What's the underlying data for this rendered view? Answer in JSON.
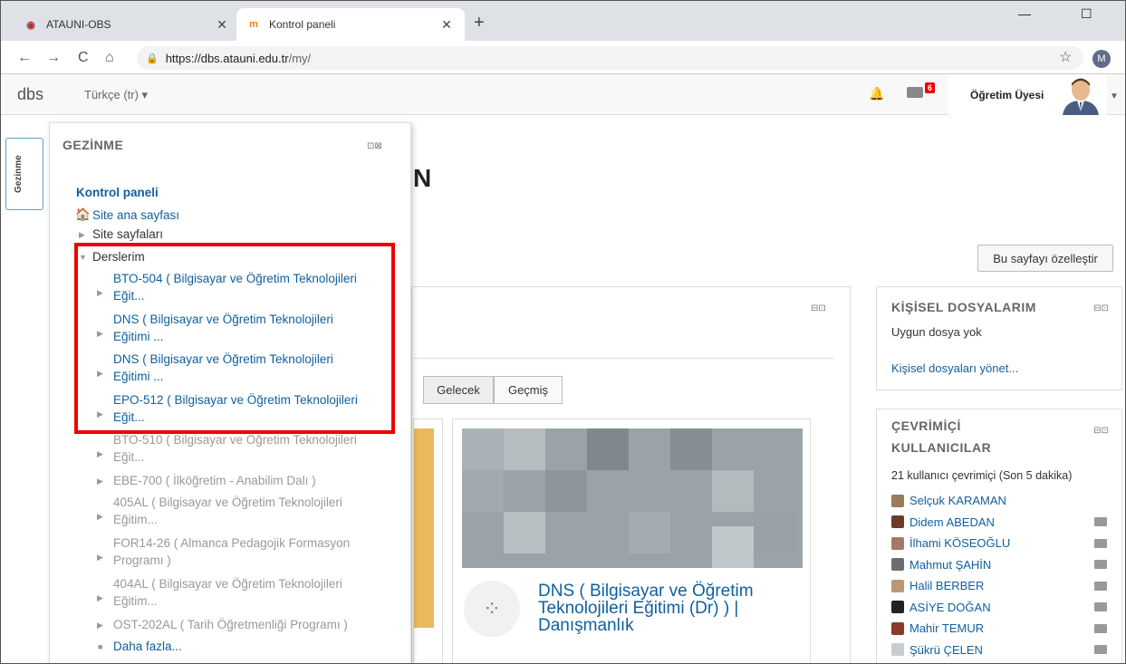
{
  "browser": {
    "tabs": [
      {
        "title": "ATAUNI-OBS",
        "favicon": "atauni-logo"
      },
      {
        "title": "Kontrol paneli",
        "favicon": "moodle-logo"
      }
    ],
    "url_host": "https://dbs.atauni.edu.tr",
    "url_path": "/my/",
    "profile_initial": "M"
  },
  "navbar": {
    "brand": "dbs",
    "language": "Türkçe (tr) ▾",
    "message_count": "6",
    "user_name": "Öğretim Üyesi"
  },
  "drawer_tab": "Gezinme",
  "nav": {
    "title": "GEZİNME",
    "dashboard": "Kontrol paneli",
    "site_home": "Site ana sayfası",
    "site_pages": "Site sayfaları",
    "my_courses": "Derslerim",
    "courses": [
      {
        "l1": "BTO-504 ( Bilgisayar ve Öğretim Teknolojileri",
        "l2": "Eğit..."
      },
      {
        "l1": "DNS ( Bilgisayar ve Öğretim Teknolojileri",
        "l2": "Eğitimi ..."
      },
      {
        "l1": "DNS ( Bilgisayar ve Öğretim Teknolojileri",
        "l2": "Eğitimi ..."
      },
      {
        "l1": "EPO-512 ( Bilgisayar ve Öğretim Teknolojileri",
        "l2": "Eğit..."
      },
      {
        "l1": "BTO-510 ( Bilgisayar ve Öğretim Teknolojileri",
        "l2": "Eğit..."
      },
      {
        "l1": "EBE-700 ( İlköğretim - Anabilim Dalı )",
        "l2": ""
      },
      {
        "l1": "405AL ( Bilgisayar ve Öğretim Teknolojileri",
        "l2": "Eğitim..."
      },
      {
        "l1": "FOR14-26 ( Almanca Pedagojik Formasyon",
        "l2": "Programı )"
      },
      {
        "l1": "404AL ( Bilgisayar ve Öğretim Teknolojileri",
        "l2": "Eğitim..."
      },
      {
        "l1": "OST-202AL ( Tarih Öğretmenliği Programı )",
        "l2": ""
      }
    ],
    "more": "Daha fazla..."
  },
  "main": {
    "heading_tail": "N",
    "customize_button": "Bu sayfayı özelleştir",
    "tab_future": "Gelecek",
    "tab_past": "Geçmiş",
    "course_card_title": "DNS ( Bilgisayar ve Öğretim Teknolojileri Eğitimi (Dr) ) | Danışmanlık"
  },
  "private_files": {
    "title": "KİŞİSEL DOSYALARIM",
    "empty": "Uygun dosya yok",
    "manage": "Kişisel dosyaları yönet..."
  },
  "online_users": {
    "title_l1": "ÇEVRİMİÇİ",
    "title_l2": "KULLANICILAR",
    "summary": "21 kullanıcı çevrimiçi (Son 5 dakika)",
    "users": [
      "Selçuk KARAMAN",
      "Didem ABEDAN",
      "İlhami KÖSEOĞLU",
      "Mahmut ŞAHİN",
      "Halil BERBER",
      "ASİYE DOĞAN",
      "Mahir TEMUR",
      "Şükrü ÇELEN"
    ]
  },
  "colors": {
    "link": "#0f5f9f",
    "highlight_box": "#e00000",
    "badge": "#e00000"
  }
}
